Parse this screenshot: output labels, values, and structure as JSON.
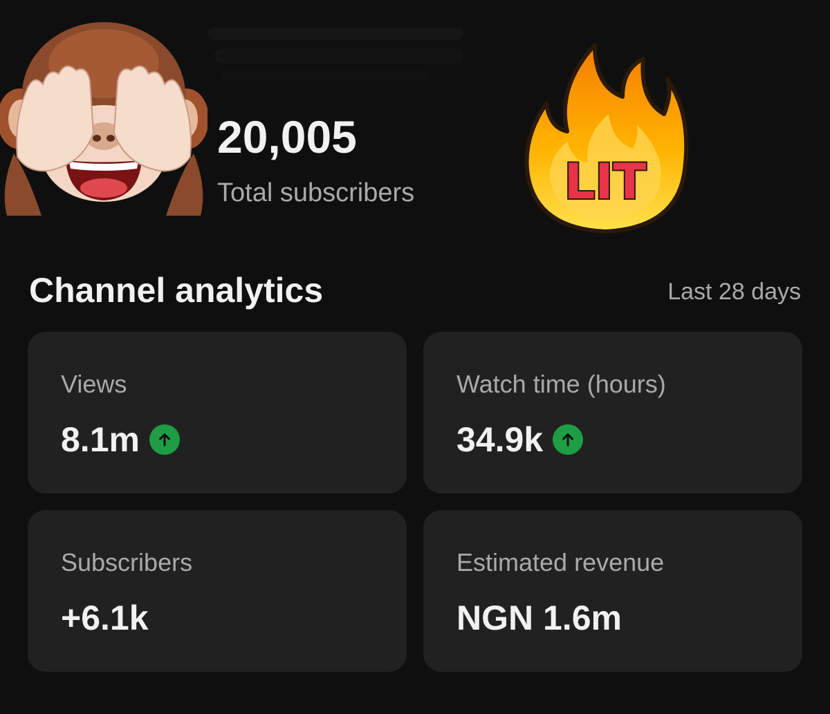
{
  "channel": {
    "total_subscribers_value": "20,005",
    "total_subscribers_label": "Total subscribers"
  },
  "stickers": {
    "left": "see-no-evil-monkey-icon",
    "right": "fire-icon",
    "right_text": "LIT"
  },
  "analytics": {
    "title": "Channel analytics",
    "period": "Last 28 days",
    "cards": [
      {
        "label": "Views",
        "value": "8.1m",
        "trend": "up"
      },
      {
        "label": "Watch time (hours)",
        "value": "34.9k",
        "trend": "up"
      },
      {
        "label": "Subscribers",
        "value": "+6.1k",
        "trend": "none"
      },
      {
        "label": "Estimated revenue",
        "value": "NGN 1.6m",
        "trend": "none"
      }
    ]
  },
  "colors": {
    "background": "#0f0f0f",
    "card": "#212121",
    "trend_up": "#1f9d44",
    "secondary_text": "#aaaaaa"
  }
}
